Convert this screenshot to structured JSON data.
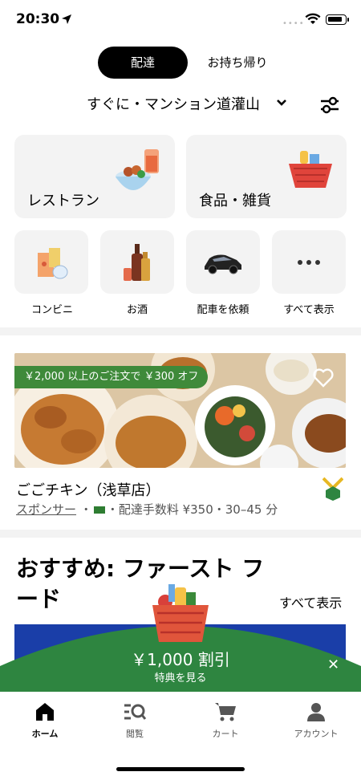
{
  "status_bar": {
    "time": "20:30"
  },
  "mode_toggle": {
    "delivery": "配達",
    "pickup": "お持ち帰り"
  },
  "address": {
    "label": "すぐに・マンション道灌山"
  },
  "categories": {
    "big": [
      {
        "label": "レストラン",
        "icon": "restaurant-food-icon"
      },
      {
        "label": "食品・雑貨",
        "icon": "grocery-basket-icon"
      }
    ],
    "small": [
      {
        "label": "コンビニ",
        "icon": "convenience-store-icon"
      },
      {
        "label": "お酒",
        "icon": "alcohol-bottles-icon"
      },
      {
        "label": "配車を依頼",
        "icon": "car-icon"
      },
      {
        "label": "すべて表示",
        "icon": "more-dots-icon"
      }
    ]
  },
  "featured_store": {
    "promo_badge": "￥2,000 以上のご注文で ￥300 オフ",
    "name": "ごごチキン（浅草店）",
    "sponsor": "スポンサー",
    "meta": "・配達手数料 ¥350・30–45 分"
  },
  "recommendation": {
    "title": "おすすめ: ファースト フード",
    "see_all": "すべて表示"
  },
  "promo_banner": {
    "amount": "￥1,000 割引",
    "subtitle": "特典を見る",
    "accent": "#2e8540"
  },
  "tabbar": [
    {
      "label": "ホーム",
      "icon": "home-icon",
      "active": true
    },
    {
      "label": "閲覧",
      "icon": "browse-icon",
      "active": false
    },
    {
      "label": "カート",
      "icon": "cart-icon",
      "active": false
    },
    {
      "label": "アカウント",
      "icon": "account-icon",
      "active": false
    }
  ]
}
